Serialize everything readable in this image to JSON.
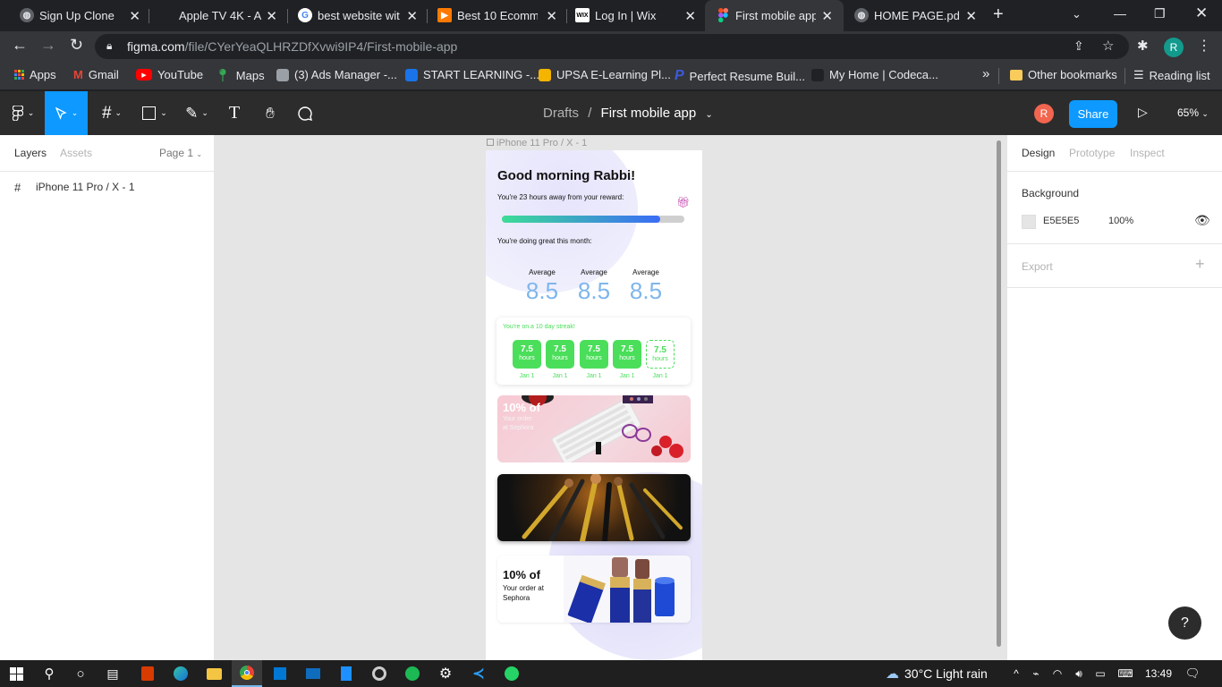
{
  "browser": {
    "tabs": [
      {
        "title": "Sign Up Clone",
        "icon": "globe-icon",
        "active": false
      },
      {
        "title": "Apple TV 4K - Ap",
        "icon": "apple-icon",
        "active": false
      },
      {
        "title": "best website with",
        "icon": "google-icon",
        "active": false
      },
      {
        "title": "Best 10 Ecommer",
        "icon": "bookmark-icon",
        "active": false
      },
      {
        "title": "Log In | Wix",
        "icon": "wix-icon",
        "active": false
      },
      {
        "title": "First mobile app",
        "icon": "figma-icon",
        "active": true
      },
      {
        "title": "HOME PAGE.pdf",
        "icon": "globe-icon",
        "active": false
      }
    ],
    "url_domain": "figma.com",
    "url_path": "/file/CYerYeaQLHRZDfXvwi9IP4/First-mobile-app",
    "profile_initial": "R",
    "bookmarks": [
      {
        "label": "Apps",
        "color": "#e8453c"
      },
      {
        "label": "Gmail",
        "color": "#ea4335"
      },
      {
        "label": "YouTube",
        "color": "#ff0000"
      },
      {
        "label": "Maps",
        "color": "#34a853"
      },
      {
        "label": "(3) Ads Manager -...",
        "color": "#9aa0a6"
      },
      {
        "label": "START LEARNING -...",
        "color": "#1a73e8"
      },
      {
        "label": "UPSA E-Learning Pl...",
        "color": "#f4b400"
      },
      {
        "label": "Perfect Resume Buil...",
        "color": "#3b5bdb"
      },
      {
        "label": "My Home | Codeca...",
        "color": "#202124"
      }
    ],
    "more_bookmarks": "»",
    "other_bookmarks": "Other bookmarks",
    "reading_list": "Reading list"
  },
  "figma": {
    "breadcrumb_parent": "Drafts",
    "breadcrumb_sep": "/",
    "file_name": "First mobile app",
    "user_initial": "R",
    "share_label": "Share",
    "zoom": "65%",
    "left_tabs": [
      "Layers",
      "Assets"
    ],
    "page_selector": "Page 1",
    "layers": [
      "iPhone 11 Pro / X - 1"
    ],
    "frame_label": "iPhone 11 Pro / X - 1",
    "right_tabs": [
      "Design",
      "Prototype",
      "Inspect"
    ],
    "background_label": "Background",
    "background_hex": "E5E5E5",
    "background_opacity": "100%",
    "export_label": "Export",
    "help_label": "?"
  },
  "app": {
    "greeting": "Good morning Rabbi!",
    "reward_text": "You're 23 hours away from your reward:",
    "reward_progress": 0.87,
    "month_text": "You're doing great this month:",
    "averages": [
      {
        "label": "Average",
        "value": "8.5"
      },
      {
        "label": "Average",
        "value": "8.5"
      },
      {
        "label": "Average",
        "value": "8.5"
      }
    ],
    "streak_text": "You're on a 10 day streak!",
    "streak_days": [
      {
        "value": "7.5",
        "unit": "hours",
        "date": "Jan 1",
        "done": true
      },
      {
        "value": "7.5",
        "unit": "hours",
        "date": "Jan 1",
        "done": true
      },
      {
        "value": "7.5",
        "unit": "hours",
        "date": "Jan 1",
        "done": true
      },
      {
        "value": "7.5",
        "unit": "hours",
        "date": "Jan 1",
        "done": true
      },
      {
        "value": "7.5",
        "unit": "hours",
        "date": "Jan 1",
        "done": false
      }
    ],
    "promo1_title": "10% of",
    "promo1_sub": "Your order at Sephora",
    "promo3_title": "10% of",
    "promo3_line1": "Your order at",
    "promo3_line2": "Sephora"
  },
  "taskbar": {
    "weather": "30°C  Light rain",
    "time": "13:49"
  },
  "colors": {
    "figma_blue": "#0d99ff",
    "progress_start": "#3ddc97",
    "progress_end": "#3b6cf6",
    "average_blue": "#7fb6ec",
    "streak_green": "#4ade5a"
  }
}
